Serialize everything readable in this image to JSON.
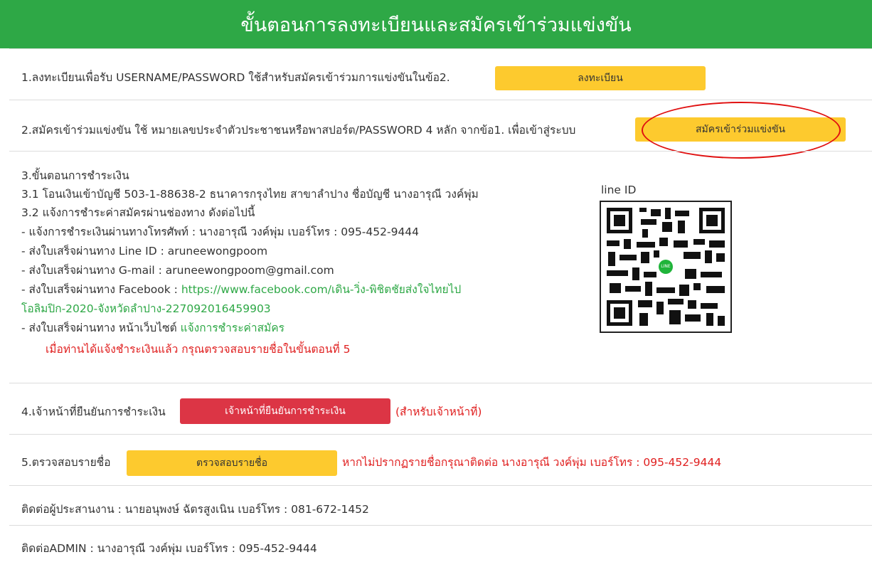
{
  "header": {
    "title": "ขั้นตอนการลงทะเบียนและสมัครเข้าร่วมแข่งขัน"
  },
  "step1": {
    "text": "1.ลงทะเบียนเพื่อรับ USERNAME/PASSWORD ใช้สำหรับสมัครเข้าร่วมการแข่งขันในข้อ2.",
    "button": "ลงทะเบียน"
  },
  "step2": {
    "text": "2.สมัครเข้าร่วมแข่งขัน ใช้ หมายเลขประจำตัวประชาชนหรือพาสปอร์ต/PASSWORD 4 หลัก จากข้อ1. เพื่อเข้าสู่ระบบ",
    "button": "สมัครเข้าร่วมแข่งขัน"
  },
  "step3": {
    "title": "3.ขั้นตอนการชำระเงิน",
    "line1": "3.1 โอนเงินเข้าบัญชี 503-1-88638-2 ธนาคารกรุงไทย สาขาลำปาง ชื่อบัญชี นางอารุณี วงค์พุ่ม",
    "line2": "3.2 แจ้งการชำระค่าสมัครผ่านช่องทาง ดังต่อไปนี้",
    "line3": "- แจ้งการชำระเงินผ่านทางโทรศัพท์ : นางอารุณี วงค์พุ่ม เบอร์โทร : 095-452-9444",
    "line4": "- ส่งใบเสร็จผ่านทาง Line ID : aruneewongpoom",
    "line5": "- ส่งใบเสร็จผ่านทาง G-mail : aruneewongpoom@gmail.com",
    "line6_prefix": "- ส่งใบเสร็จผ่านทาง Facebook : ",
    "facebook_link_1": "https://www.facebook.com/เดิน-วิ่ง-พิชิตชัยส่งใจไทยไป",
    "facebook_link_2": "โอลิมปิก-2020-จังหวัดลำปาง-227092016459903",
    "line7_prefix": "- ส่งใบเสร็จผ่านทาง หน้าเว็บไซต์ ",
    "line7_link": "แจ้งการชำระค่าสมัคร",
    "notice": "เมื่อท่านได้แจ้งชำระเงินแล้ว กรุณตรวจสอบรายชื่อในขั้นตอนที่ 5",
    "qr_label": "line ID",
    "qr_badge": "LINE"
  },
  "step4": {
    "text": "4.เจ้าหน้าที่ยืนยันการชำระเงิน",
    "button": "เจ้าหน้าที่ยืนยันการชำระเงิน",
    "note": "(สำหรับเจ้าหน้าที่)"
  },
  "step5": {
    "text": "5.ตรวจสอบรายชื่อ",
    "button": "ตรวจสอบรายชื่อ",
    "note": "หากไม่ปรากฏรายชื่อกรุณาติดต่อ นางอารุณี วงค์พุ่ม เบอร์โทร : 095-452-9444"
  },
  "contact": {
    "coordinator": "ติดต่อผู้ประสานงาน : นายอนุพงษ์ ฉัตรสูงเนิน เบอร์โทร : 081-672-1452",
    "admin": "ติดต่อADMIN : นางอารุณี วงค์พุ่ม เบอร์โทร : 095-452-9444"
  },
  "colors": {
    "header_green": "#2ea846",
    "button_yellow": "#fdca2e",
    "button_red": "#dc3545",
    "highlight_red": "#e01010"
  }
}
